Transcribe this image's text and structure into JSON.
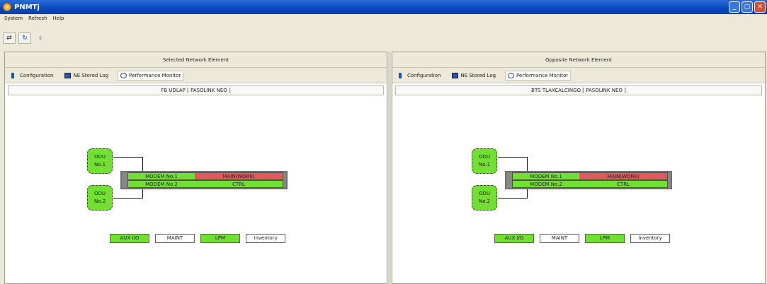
{
  "window": {
    "title": "PNMTj",
    "buttons": [
      "_",
      "▢",
      "✕"
    ]
  },
  "menu": [
    "System",
    "Refresh",
    "Help"
  ],
  "toolbar": {
    "icons": [
      "network-icon",
      "refresh-icon",
      "sound-icon"
    ]
  },
  "tabs": [
    "Configuration",
    "NE Stored Log",
    "Performance Monitor"
  ],
  "panels": [
    {
      "title": "Selected Network Element",
      "ne": "FB UDLAP [ PASOLINK NEO ]",
      "odu1": [
        "ODU",
        "No.1"
      ],
      "odu2": [
        "ODU",
        "No.2"
      ],
      "modem1": "MODEM No.1",
      "modem2": "MODEM No.2",
      "status1": "MAIN(WORK)",
      "status2": "CTRL",
      "buttons": [
        "AUX I/O",
        "MAINT",
        "LPM",
        "Inventory"
      ]
    },
    {
      "title": "Opposite Network Element",
      "ne": "BTS TLAXCALCINGO [ PASOLINK NEO ]",
      "odu1": [
        "ODU",
        "No.1"
      ],
      "odu2": [
        "ODU",
        "No.2"
      ],
      "modem1": "MODEM No.1",
      "modem2": "MODEM No.2",
      "status1": "MAIN(WORK)",
      "status2": "CTRL",
      "buttons": [
        "AUX I/O",
        "MAINT",
        "LPM",
        "Inventory"
      ]
    }
  ],
  "colors": {
    "ok": "#72e030",
    "alarm": "#e05a5a",
    "titlebar": "#0a47c0"
  }
}
